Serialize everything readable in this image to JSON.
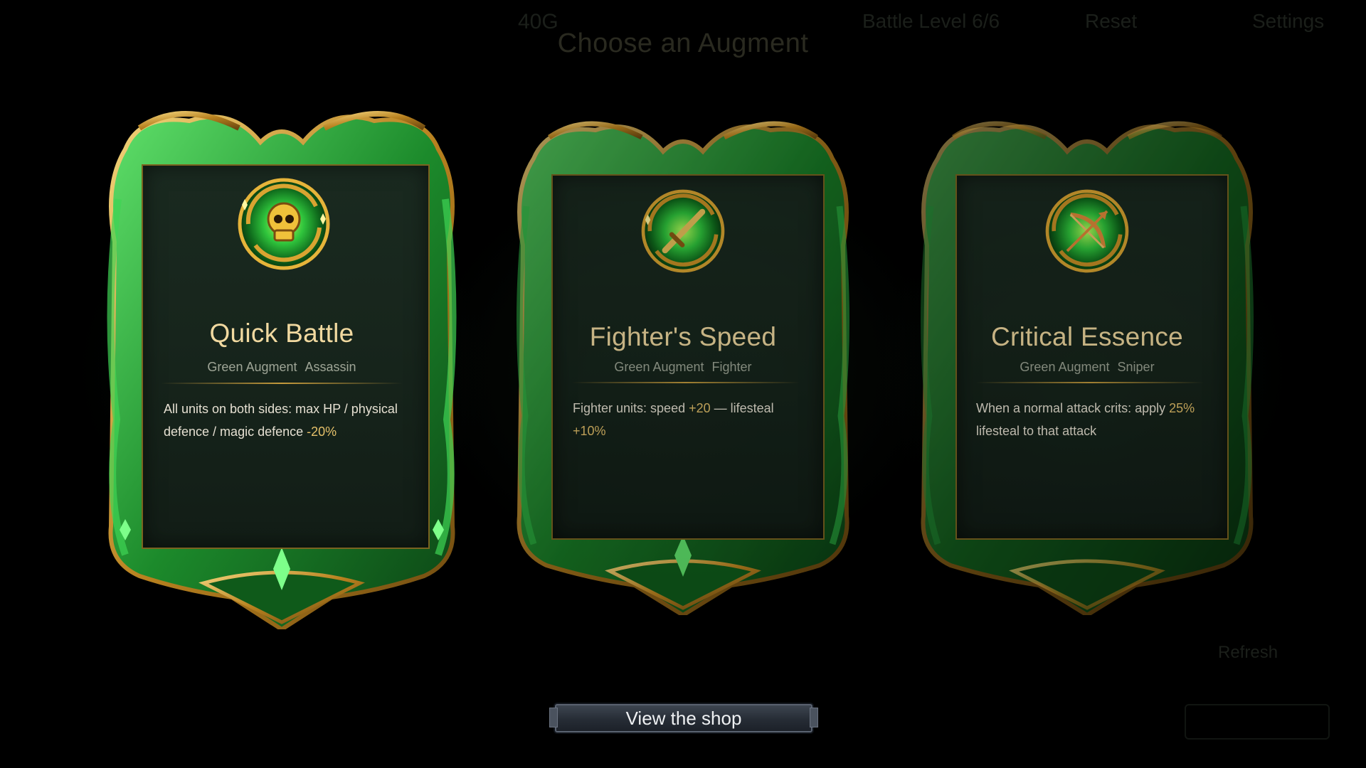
{
  "hud": {
    "gold": "40G",
    "status": "Battle Level 6/6",
    "reset": "Reset",
    "settings": "Settings",
    "refresh": "Refresh"
  },
  "overlay_title": "Choose an Augment",
  "cards": [
    {
      "name": "Quick Battle",
      "tier": "Green Augment",
      "trait": "Assassin",
      "icon": "skull-icon",
      "desc_parts": [
        "All units on both sides: max HP / physical defence / magic defence ",
        "-20%",
        ""
      ]
    },
    {
      "name": "Fighter's Speed",
      "tier": "Green Augment",
      "trait": "Fighter",
      "icon": "sword-icon",
      "desc_parts": [
        "Fighter units: speed ",
        "+20",
        " — lifesteal ",
        "+10%"
      ]
    },
    {
      "name": "Critical Essence",
      "tier": "Green Augment",
      "trait": "Sniper",
      "icon": "bow-icon",
      "desc_parts": [
        "When a normal attack crits: apply ",
        "25%",
        " lifesteal to that attack",
        ""
      ]
    }
  ],
  "shop_button": "View the shop",
  "colors": {
    "frame_gold": "#c4922c",
    "frame_green": "#1f8a2e",
    "panel": "#17251c",
    "title_gold": "#f1d9a0",
    "highlight": "#e5c06a"
  }
}
